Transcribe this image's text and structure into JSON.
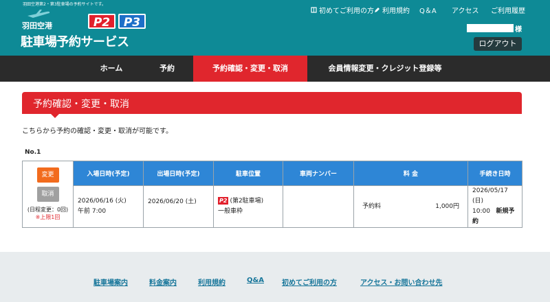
{
  "header": {
    "tagline": "羽田空港第2・第3駐車場の予約サイトです。",
    "logo": {
      "airport": "羽田空港",
      "p2": "P2",
      "p3": "P3",
      "service": "駐車場予約サービス"
    },
    "top_links": [
      {
        "label": "初めてご利用の方",
        "icon": "book-icon"
      },
      {
        "label": "利用規約",
        "icon": "pencil-icon"
      },
      {
        "label": "Q＆A"
      },
      {
        "label": "アクセス"
      },
      {
        "label": "ご利用履歴"
      }
    ],
    "user_suffix": "様",
    "logout_label": "ログアウト"
  },
  "main_nav": [
    {
      "label": "ホーム",
      "active": false
    },
    {
      "label": "予約",
      "active": false
    },
    {
      "label": "予約確認・変更・取消",
      "active": true
    },
    {
      "label": "会員情報変更・クレジット登録等",
      "active": false
    }
  ],
  "page": {
    "title": "予約確認・変更・取消",
    "lead": "こちらから予約の確認・変更・取消が可能です。",
    "record_no": "No.1"
  },
  "table": {
    "headers": [
      "入場日時(予定)",
      "出場日時(予定)",
      "駐車位置",
      "車両ナンバー",
      "料 金",
      "手続き日時"
    ],
    "actions": {
      "change_label": "変更",
      "cancel_label": "取消",
      "schedule_change": "(日程変更：0回)",
      "limit": "※上限1回"
    },
    "row": {
      "entry_date": "2026/06/16 (火)",
      "entry_time": "午前 7:00",
      "exit_date": "2026/06/20 (土)",
      "parking_badge": "P2",
      "parking_name": "(第2駐車場)",
      "parking_type": "一般車枠",
      "vehicle_number": "",
      "fee_label": "予約料",
      "fee_amount": "1,000円",
      "proc_date": "2026/05/17 (日)",
      "proc_time": "10:00",
      "proc_type": "新規予約"
    }
  },
  "footer": {
    "links": [
      "駐車場案内",
      "料金案内",
      "利用規約",
      "Q&A",
      "初めてご利用の方",
      "アクセス・お問い合わせ先"
    ]
  },
  "colors": {
    "header_bg": "#0e8a96",
    "nav_bg": "#2b2b2b",
    "accent_red": "#e0262d",
    "table_header_blue": "#2e86d6",
    "change_orange": "#f26b1d",
    "footer_bg": "#e8ecee",
    "footer_link": "#17769a"
  }
}
